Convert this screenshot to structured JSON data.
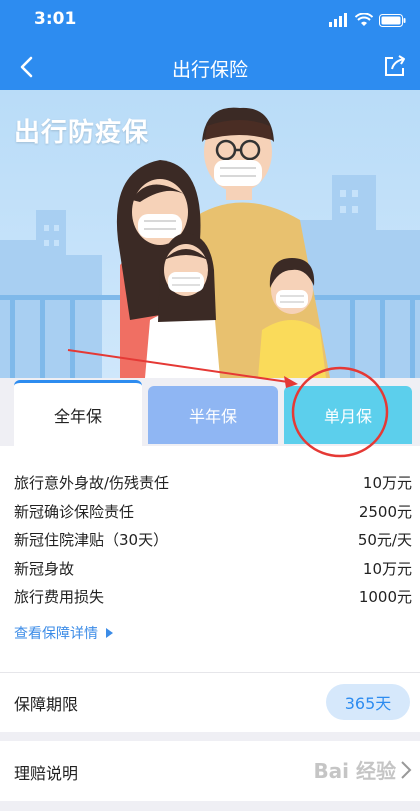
{
  "status_bar": {
    "time": "3:01"
  },
  "nav": {
    "title": "出行保险"
  },
  "banner": {
    "heading": "出行防疫保"
  },
  "tabs": [
    {
      "label": "全年保",
      "active": true
    },
    {
      "label": "半年保",
      "active": false
    },
    {
      "label": "单月保",
      "active": false
    }
  ],
  "coverage": {
    "items": [
      {
        "name": "旅行意外身故/伤残责任",
        "amount": "10万元"
      },
      {
        "name": "新冠确诊保险责任",
        "amount": "2500元"
      },
      {
        "name": "新冠住院津贴（30天）",
        "amount": "50元/天"
      },
      {
        "name": "新冠身故",
        "amount": "10万元"
      },
      {
        "name": "旅行费用损失",
        "amount": "1000元"
      }
    ],
    "detail_link": "查看保障详情"
  },
  "period": {
    "label": "保障期限",
    "value": "365天"
  },
  "claims": {
    "label": "理赔说明"
  },
  "watermark": "Bai 经验",
  "colors": {
    "brand": "#2d8cf0",
    "annotation": "#e53935"
  }
}
